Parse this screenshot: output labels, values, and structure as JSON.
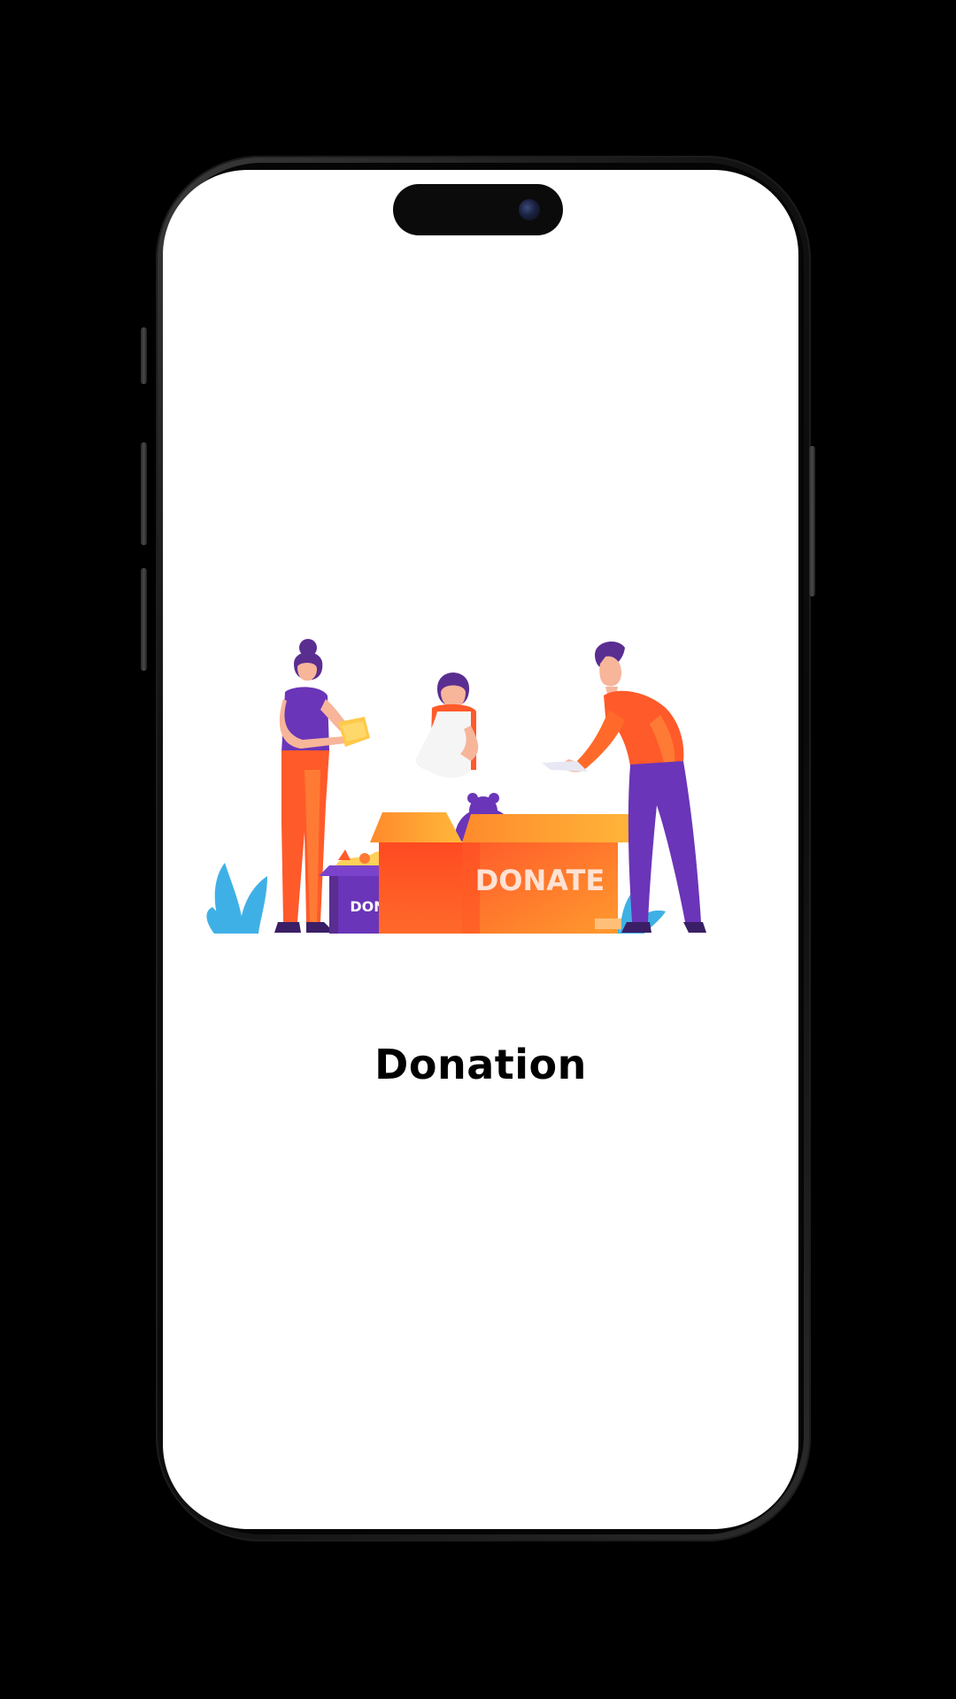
{
  "screen": {
    "title": "Donation"
  },
  "illustration": {
    "big_box_label": "DONATE",
    "small_box_label": "DONATE",
    "name": "donation-illustration"
  },
  "colors": {
    "background": "#000000",
    "screen": "#ffffff",
    "title": "#000000",
    "orange": "#ff5a2a",
    "orange_light": "#ffa234",
    "purple": "#6a35b8",
    "blue": "#3fb0e6",
    "skin": "#f7b59a"
  }
}
